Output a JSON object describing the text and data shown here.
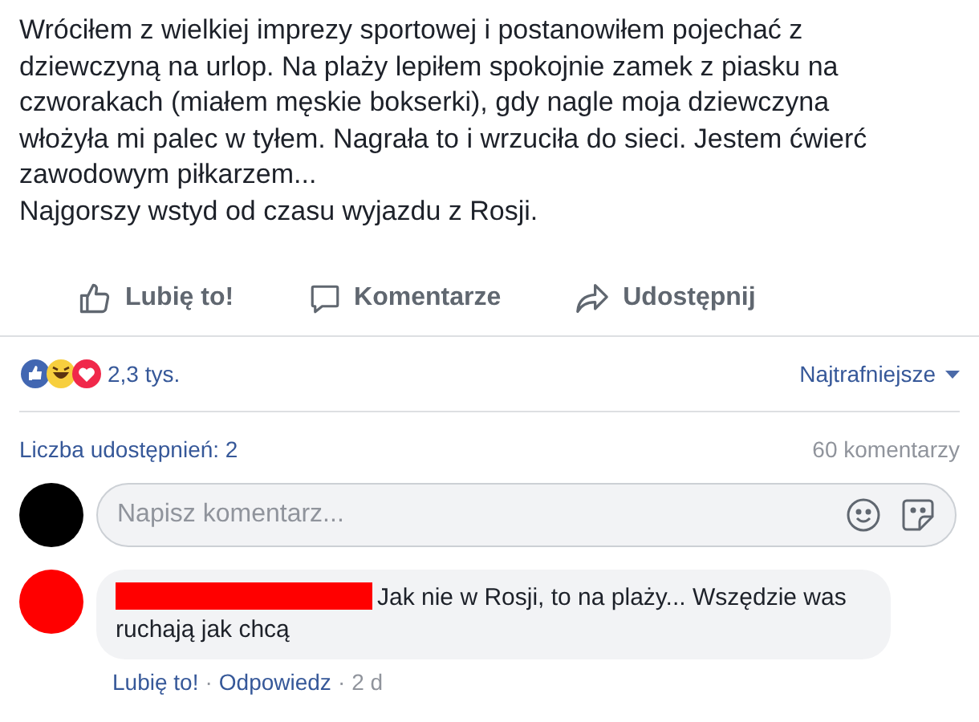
{
  "post": {
    "paragraphs": [
      "Wróciłem z wielkiej imprezy sportowej i postanowiłem pojechać z dziewczyną na urlop. Na plaży lepiłem spokojnie zamek z piasku na czworakach (miałem męskie bokserki), gdy nagle moja dziewczyna włożyła mi palec w tyłem. Nagrała to i wrzuciła do sieci. Jestem ćwierć zawodowym piłkarzem...",
      "Najgorszy wstyd od czasu wyjazdu z Rosji."
    ]
  },
  "actions": [
    {
      "kind": "like",
      "label": "Lubię to!"
    },
    {
      "kind": "comment",
      "label": "Komentarze"
    },
    {
      "kind": "share",
      "label": "Udostępnij"
    }
  ],
  "reactions": {
    "count": "2,3 tys.",
    "sort": "Najtrafniejsze"
  },
  "shares": "Liczba udostępnień: 2",
  "comments_count": "60 komentarzy",
  "composer": {
    "placeholder": "Napisz komentarz..."
  },
  "comments": [
    {
      "color": "#ff0000",
      "redacted": true,
      "separator": "·",
      "text": "Jak nie w Rosji, to na plaży... Wszędzie was ruchają jak chcą",
      "like": "Lubię to!",
      "reply": "Odpowiedz",
      "time": "2 d"
    }
  ]
}
